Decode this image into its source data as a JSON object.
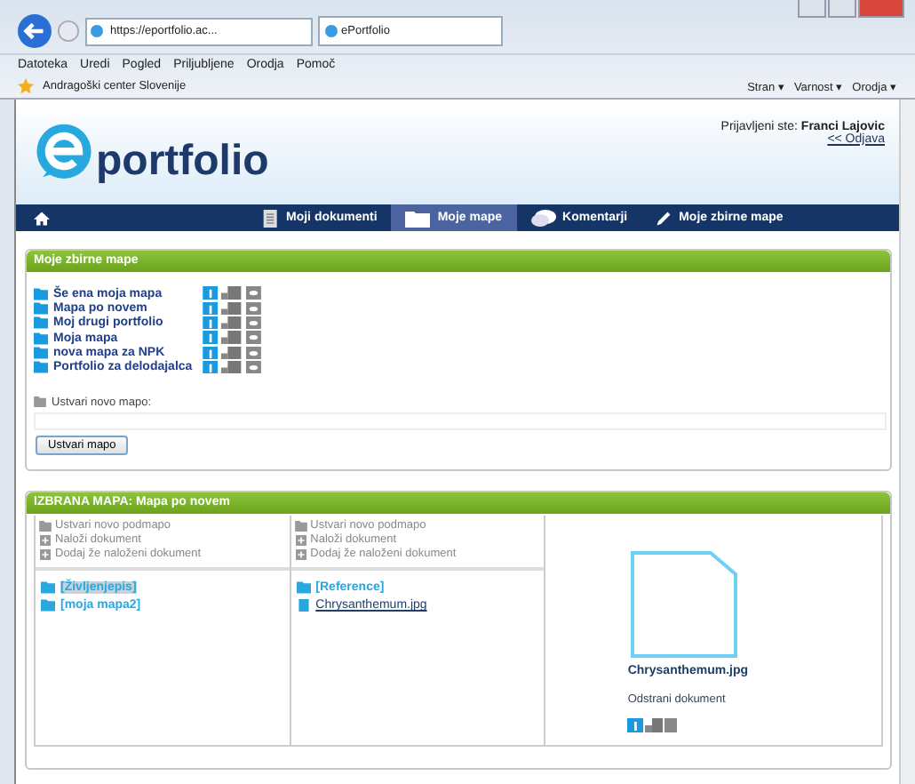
{
  "browser": {
    "address": "https://eportfolio.ac...",
    "tabs": [
      {
        "label": "ePortfolio",
        "selected": true
      }
    ],
    "menu": [
      "Datoteka",
      "Uredi",
      "Pogled",
      "Priljubljene",
      "Orodja",
      "Pomoč"
    ],
    "favorites": [
      "Andragoški center Slovenije"
    ],
    "commands": [
      "Stran ▾",
      "Varnost ▾",
      "Orodja ▾"
    ]
  },
  "header": {
    "logo_text": "portfolio",
    "login_label": "Prijavljeni ste:",
    "user": "Franci Lajovic",
    "logout": "<< Odjava"
  },
  "nav": [
    {
      "kind": "home",
      "selected": false
    },
    {
      "kind": "documents",
      "label": "Moji dokumenti",
      "selected": false
    },
    {
      "kind": "folders",
      "label": "Moje mape",
      "selected": true
    },
    {
      "kind": "comments",
      "label": "Komentarji",
      "selected": false
    },
    {
      "kind": "collections",
      "label": "Moje zbirne mape",
      "selected": false
    }
  ],
  "collections": {
    "title": "Moje zbirne mape",
    "folders": [
      "Še ena moja mapa",
      "Mapa po novem",
      "Moj drugi portfolio",
      "Moja mapa",
      "nova mapa za NPK",
      "Portfolio za delodajalca"
    ],
    "new_folder_label": "Ustvari novo mapo:",
    "button": "Ustvari mapo"
  },
  "selected_folder": {
    "title": "IZBRANA MAPA: Mapa po novem",
    "columns": [
      {
        "actions": [
          {
            "kind": "folder",
            "label": "Ustvari novo podmapo"
          },
          {
            "kind": "add",
            "label": "Naloži dokument"
          },
          {
            "kind": "add",
            "label": "Dodaj že naloženi dokument"
          }
        ],
        "items": [
          {
            "kind": "folder",
            "label": "[Življenjepis]",
            "selected": true
          },
          {
            "kind": "folder",
            "label": "[moja mapa2]",
            "selected": false
          }
        ]
      },
      {
        "actions": [
          {
            "kind": "folder",
            "label": "Ustvari novo podmapo"
          },
          {
            "kind": "add",
            "label": "Naloži dokument"
          },
          {
            "kind": "add",
            "label": "Dodaj že naloženi dokument"
          }
        ],
        "items": [
          {
            "kind": "folder",
            "label": "[Reference]",
            "selected": false
          },
          {
            "kind": "file",
            "label": "Chrysanthemum.jpg",
            "selected": false
          }
        ]
      }
    ],
    "preview": {
      "filename": "Chrysanthemum.jpg",
      "action": "Odstrani dokument"
    }
  }
}
